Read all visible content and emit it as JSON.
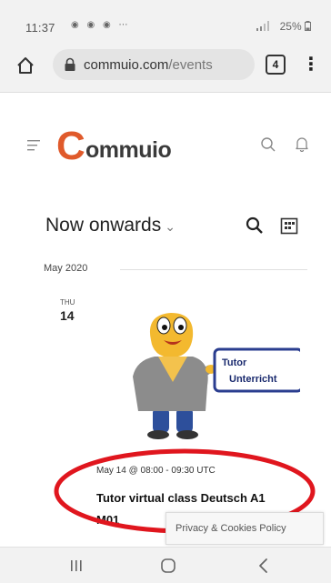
{
  "status_bar": {
    "time": "11:37",
    "icons_text": "◉ ◉ ◉  ⋯",
    "right_text": "   25%"
  },
  "browser": {
    "url_domain": "commuio.com",
    "url_path": "/events",
    "tab_count": "4"
  },
  "site": {
    "logo_initial": "C",
    "logo_rest": "ommuio"
  },
  "events": {
    "filter_label": "Now onwards",
    "filter_caret": "⌄",
    "month": "May 2020",
    "day_name": "THU",
    "day_number": "14",
    "sign_line1": "Tutor",
    "sign_line2": "Unterricht",
    "event": {
      "datetime": "May 14 @ 08:00 - 09:30 UTC",
      "title_line1": "Tutor virtual class Deutsch A1",
      "title_line2": "M01"
    }
  },
  "privacy": {
    "label": "Privacy & Cookies Policy"
  },
  "colors": {
    "brand": "#e05a2b",
    "highlight": "#e0161e"
  }
}
